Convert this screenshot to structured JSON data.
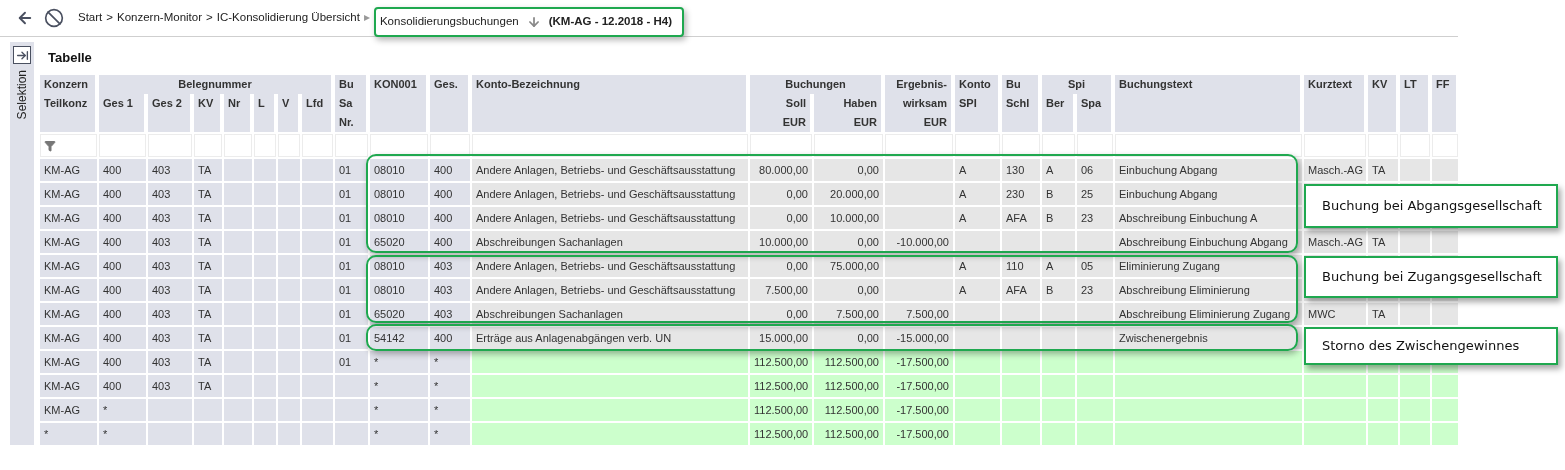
{
  "breadcrumb": [
    {
      "label": "Start"
    },
    {
      "separator": ">",
      "label": "Konzern-Monitor"
    },
    {
      "separator": ">",
      "label": "IC-Konsolidierung Übersicht"
    },
    {
      "separator": "▸",
      "label": "Konsolidierungsbuchungen"
    }
  ],
  "context": "(KM-AG - 12.2018 - H4)",
  "sidebar": {
    "label": "Selektion"
  },
  "table": {
    "title": "Tabelle",
    "columns": [
      {
        "kind": "key",
        "grouped": false,
        "lines": [
          "Konzern",
          "Teilkonz"
        ]
      },
      {
        "kind": "key",
        "grouped": true,
        "group": "Belegnummer",
        "lines": [
          "Ges 1"
        ]
      },
      {
        "kind": "key",
        "grouped": true,
        "lines": [
          "Ges 2"
        ]
      },
      {
        "kind": "key",
        "grouped": true,
        "lines": [
          "KV"
        ]
      },
      {
        "kind": "key",
        "grouped": true,
        "lines": [
          "Nr"
        ]
      },
      {
        "kind": "key",
        "grouped": true,
        "lines": [
          "L"
        ]
      },
      {
        "kind": "key",
        "grouped": true,
        "lines": [
          "V"
        ]
      },
      {
        "kind": "key",
        "grouped": true,
        "lines": [
          "Lfd"
        ]
      },
      {
        "kind": "key",
        "grouped": false,
        "lines": [
          "Bu",
          "Sa",
          "Nr."
        ]
      },
      {
        "kind": "key",
        "grouped": false,
        "lines": [
          "KON001"
        ]
      },
      {
        "kind": "key",
        "grouped": false,
        "lines": [
          "Ges."
        ]
      },
      {
        "kind": "text",
        "grouped": false,
        "lines": [
          "Konto-Bezeichnung"
        ]
      },
      {
        "kind": "amount",
        "grouped": true,
        "group": "Buchungen",
        "lines": [
          "Soll",
          "EUR"
        ]
      },
      {
        "kind": "amount",
        "grouped": true,
        "lines": [
          "Haben",
          "EUR"
        ]
      },
      {
        "kind": "amount",
        "grouped": false,
        "lines": [
          "Ergebnis-",
          "wirksam",
          "EUR"
        ]
      },
      {
        "kind": "text",
        "grouped": false,
        "lines": [
          "Konto",
          "SPI"
        ]
      },
      {
        "kind": "text",
        "grouped": false,
        "lines": [
          "Bu",
          "Schl"
        ]
      },
      {
        "kind": "text",
        "grouped": true,
        "group": "Spi",
        "lines": [
          "Ber"
        ]
      },
      {
        "kind": "text",
        "grouped": true,
        "lines": [
          "Spa"
        ]
      },
      {
        "kind": "text",
        "grouped": false,
        "lines": [
          "Buchungstext"
        ]
      },
      {
        "kind": "text",
        "grouped": false,
        "lines": [
          "Kurztext"
        ]
      },
      {
        "kind": "text",
        "grouped": false,
        "lines": [
          "KV"
        ]
      },
      {
        "kind": "text",
        "grouped": false,
        "lines": [
          "LT"
        ]
      },
      {
        "kind": "text",
        "grouped": false,
        "lines": [
          "FF"
        ]
      }
    ],
    "rows": [
      {
        "kind": "booking",
        "cells": [
          "KM-AG",
          "400",
          "403",
          "TA",
          null,
          null,
          null,
          null,
          "01",
          "08010",
          "400",
          "Andere Anlagen, Betriebs- und Geschäftsausstattung",
          "80.000,00",
          "0,00",
          null,
          "A",
          "130",
          "A",
          "06",
          "Einbuchung Abgang",
          "Masch.-AG",
          "TA",
          null,
          null
        ]
      },
      {
        "kind": "booking",
        "cells": [
          "KM-AG",
          "400",
          "403",
          "TA",
          null,
          null,
          null,
          null,
          "01",
          "08010",
          "400",
          "Andere Anlagen, Betriebs- und Geschäftsausstattung",
          "0,00",
          "20.000,00",
          null,
          "A",
          "230",
          "B",
          "25",
          "Einbuchung Abgang",
          null,
          null,
          null,
          null
        ]
      },
      {
        "kind": "booking",
        "cells": [
          "KM-AG",
          "400",
          "403",
          "TA",
          null,
          null,
          null,
          null,
          "01",
          "08010",
          "400",
          "Andere Anlagen, Betriebs- und Geschäftsausstattung",
          "0,00",
          "10.000,00",
          null,
          "A",
          "AFA",
          "B",
          "23",
          "Abschreibung Einbuchung A",
          null,
          null,
          null,
          null
        ]
      },
      {
        "kind": "booking",
        "cells": [
          "KM-AG",
          "400",
          "403",
          "TA",
          null,
          null,
          null,
          null,
          "01",
          "65020",
          "400",
          "Abschreibungen Sachanlagen",
          "10.000,00",
          "0,00",
          "-10.000,00",
          null,
          null,
          null,
          null,
          "Abschreibung Einbuchung Abgang",
          "Masch.-AG",
          "TA",
          null,
          null
        ]
      },
      {
        "kind": "booking",
        "cells": [
          "KM-AG",
          "400",
          "403",
          "TA",
          null,
          null,
          null,
          null,
          "01",
          "08010",
          "403",
          "Andere Anlagen, Betriebs- und Geschäftsausstattung",
          "0,00",
          "75.000,00",
          null,
          "A",
          "110",
          "A",
          "05",
          "Eliminierung Zugang",
          null,
          null,
          null,
          null
        ]
      },
      {
        "kind": "booking",
        "cells": [
          "KM-AG",
          "400",
          "403",
          "TA",
          null,
          null,
          null,
          null,
          "01",
          "08010",
          "403",
          "Andere Anlagen, Betriebs- und Geschäftsausstattung",
          "7.500,00",
          "0,00",
          null,
          "A",
          "AFA",
          "B",
          "23",
          "Abschreibung Eliminierung",
          null,
          null,
          null,
          null
        ]
      },
      {
        "kind": "booking",
        "cells": [
          "KM-AG",
          "400",
          "403",
          "TA",
          null,
          null,
          null,
          null,
          "01",
          "65020",
          "403",
          "Abschreibungen Sachanlagen",
          "0,00",
          "7.500,00",
          "7.500,00",
          null,
          null,
          null,
          null,
          "Abschreibung Eliminierung Zugang",
          "MWC",
          "TA",
          null,
          null
        ]
      },
      {
        "kind": "booking",
        "cells": [
          "KM-AG",
          "400",
          "403",
          "TA",
          null,
          null,
          null,
          null,
          "01",
          "54142",
          "400",
          "Erträge aus Anlagenabgängen verb. UN",
          "15.000,00",
          "0,00",
          "-15.000,00",
          null,
          null,
          null,
          null,
          "Zwischenergebnis",
          null,
          null,
          null,
          null
        ]
      },
      {
        "kind": "total",
        "cells": [
          "KM-AG",
          "400",
          "403",
          "TA",
          null,
          null,
          null,
          null,
          "01",
          "*",
          "*",
          null,
          "112.500,00",
          "112.500,00",
          "-17.500,00",
          null,
          null,
          null,
          null,
          null,
          null,
          null,
          null,
          null
        ]
      },
      {
        "kind": "total",
        "cells": [
          "KM-AG",
          "400",
          "403",
          "TA",
          null,
          null,
          null,
          null,
          null,
          "*",
          "*",
          null,
          "112.500,00",
          "112.500,00",
          "-17.500,00",
          null,
          null,
          null,
          null,
          null,
          null,
          null,
          null,
          null
        ]
      },
      {
        "kind": "total",
        "cells": [
          "KM-AG",
          "*",
          null,
          null,
          null,
          null,
          null,
          null,
          null,
          "*",
          "*",
          null,
          "112.500,00",
          "112.500,00",
          "-17.500,00",
          null,
          null,
          null,
          null,
          null,
          null,
          null,
          null,
          null
        ]
      },
      {
        "kind": "total",
        "cells": [
          "*",
          "*",
          null,
          null,
          null,
          null,
          null,
          null,
          null,
          "*",
          "*",
          null,
          "112.500,00",
          "112.500,00",
          "-17.500,00",
          null,
          null,
          null,
          null,
          null,
          null,
          null,
          null,
          null
        ]
      }
    ]
  },
  "annotations": [
    {
      "text": "Buchung bei Abgangsgesellschaft"
    },
    {
      "text": "Buchung bei Zugangsgesellschaft"
    },
    {
      "text": "Storno des Zwischengewinnes"
    }
  ]
}
